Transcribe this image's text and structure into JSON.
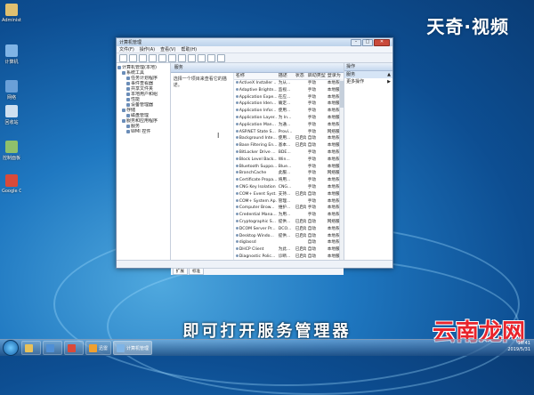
{
  "desktop": {
    "icons": [
      {
        "label": "Administr...",
        "icon": "user-folder-icon",
        "color": "#e0c070"
      },
      {
        "label": "计算机",
        "icon": "computer-icon",
        "color": "#7fb4e6"
      },
      {
        "label": "网络",
        "icon": "network-icon",
        "color": "#6aa0d8"
      },
      {
        "label": "回收站",
        "icon": "recycle-bin-icon",
        "color": "#cfe0f0"
      },
      {
        "label": "控制面板",
        "icon": "control-panel-icon",
        "color": "#8fc06b"
      },
      {
        "label": "Google Chrome",
        "icon": "chrome-icon",
        "color": "#d94a3a"
      }
    ]
  },
  "watermark": "天奇·视频",
  "brand": "云南龙网",
  "subtitle": "即可打开服务管理器",
  "window": {
    "title": "计算机管理",
    "menu": [
      "文件(F)",
      "操作(A)",
      "查看(V)",
      "帮助(H)"
    ],
    "tree": [
      {
        "label": "计算机管理(本地)",
        "indent": 0
      },
      {
        "label": "系统工具",
        "indent": 1
      },
      {
        "label": "任务计划程序",
        "indent": 2
      },
      {
        "label": "事件查看器",
        "indent": 2
      },
      {
        "label": "共享文件夹",
        "indent": 2
      },
      {
        "label": "本地用户和组",
        "indent": 2
      },
      {
        "label": "性能",
        "indent": 2
      },
      {
        "label": "设备管理器",
        "indent": 2
      },
      {
        "label": "存储",
        "indent": 1
      },
      {
        "label": "磁盘管理",
        "indent": 2
      },
      {
        "label": "服务和应用程序",
        "indent": 1
      },
      {
        "label": "服务",
        "indent": 2
      },
      {
        "label": "WMI 控件",
        "indent": 2
      }
    ],
    "services_header": "服务",
    "description": "选择一个项目来查看它的描述。",
    "columns": [
      "名称",
      "描述",
      "状态",
      "启动类型",
      "登录为"
    ],
    "rows": [
      [
        "ActiveX Installer ...",
        "为从...",
        "",
        "手动",
        "本地系统"
      ],
      [
        "Adaptive Brightn...",
        "监视...",
        "",
        "手动",
        "本地服务"
      ],
      [
        "Application Expe...",
        "在应...",
        "",
        "手动",
        "本地系统"
      ],
      [
        "Application Iden...",
        "确定...",
        "",
        "手动",
        "本地服务"
      ],
      [
        "Application Infor...",
        "使用...",
        "",
        "手动",
        "本地系统"
      ],
      [
        "Application Layer...",
        "为 In...",
        "",
        "手动",
        "本地服务"
      ],
      [
        "Application Man...",
        "为通...",
        "",
        "手动",
        "本地系统"
      ],
      [
        "ASP.NET State S...",
        "Provi...",
        "",
        "手动",
        "网络服务"
      ],
      [
        "Background Inte...",
        "使用...",
        "已启动",
        "自动",
        "本地系统"
      ],
      [
        "Base Filtering En...",
        "基本...",
        "已启动",
        "自动",
        "本地服务"
      ],
      [
        "BitLocker Drive ...",
        "BDE...",
        "",
        "手动",
        "本地系统"
      ],
      [
        "Block Level Back...",
        "Win...",
        "",
        "手动",
        "本地系统"
      ],
      [
        "Bluetooth Suppo...",
        "Blue...",
        "",
        "手动",
        "本地服务"
      ],
      [
        "BranchCache",
        "此服...",
        "",
        "手动",
        "网络服务"
      ],
      [
        "Certificate Propa...",
        "将用...",
        "",
        "手动",
        "本地系统"
      ],
      [
        "CNG Key Isolation",
        "CNG...",
        "",
        "手动",
        "本地系统"
      ],
      [
        "COM+ Event Syst...",
        "支持...",
        "已启动",
        "自动",
        "本地服务"
      ],
      [
        "COM+ System Ap...",
        "管理...",
        "",
        "手动",
        "本地系统"
      ],
      [
        "Computer Brow...",
        "维护...",
        "已启动",
        "手动",
        "本地系统"
      ],
      [
        "Credential Mana...",
        "为用...",
        "",
        "手动",
        "本地系统"
      ],
      [
        "Cryptographic S...",
        "提供...",
        "已启动",
        "自动",
        "网络服务"
      ],
      [
        "DCOM Server Pr...",
        "DCO...",
        "已启动",
        "自动",
        "本地系统"
      ],
      [
        "Desktop Windo...",
        "提供...",
        "已启动",
        "自动",
        "本地系统"
      ],
      [
        "diglassd",
        "",
        "",
        "自动",
        "本地系统"
      ],
      [
        "DHCP Client",
        "为此...",
        "已启动",
        "自动",
        "本地服务"
      ],
      [
        "Diagnostic Polic...",
        "诊断...",
        "已启动",
        "自动",
        "本地服务"
      ],
      [
        "Diagnostic Servi...",
        "诊断...",
        "",
        "手动",
        "本地服务"
      ]
    ],
    "tabs": [
      "扩展",
      "标准"
    ],
    "actions": {
      "header": "操作",
      "items": [
        {
          "label": "服务",
          "selected": true,
          "arrow": "▲"
        },
        {
          "label": "更多操作",
          "selected": false,
          "arrow": "▶"
        }
      ]
    }
  },
  "taskbar": {
    "items": [
      {
        "label": "",
        "icon": "explorer-icon",
        "color": "#e8c15a"
      },
      {
        "label": "",
        "icon": "media-player-icon",
        "color": "#4f8fd6"
      },
      {
        "label": "",
        "icon": "chrome-icon",
        "color": "#d94a3a"
      },
      {
        "label": "迅雷",
        "icon": "download-app-icon",
        "color": "#f0a030"
      },
      {
        "label": "计算机管理",
        "icon": "computer-management-icon",
        "color": "#7fb4e6",
        "active": true
      }
    ],
    "time": "16:41",
    "date": "2019/5/31"
  }
}
